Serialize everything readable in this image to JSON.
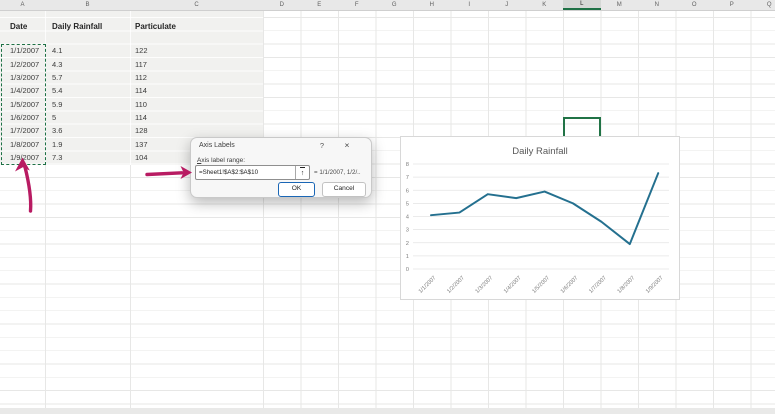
{
  "sheet": {
    "column_letters": [
      "A",
      "B",
      "C",
      "D",
      "E",
      "F",
      "G",
      "H",
      "I",
      "J",
      "K",
      "L",
      "M",
      "N",
      "O",
      "P",
      "Q"
    ],
    "active_column": "L",
    "table": {
      "headers": [
        "Date",
        "Daily Rainfall",
        "Particulate"
      ],
      "rows": [
        [
          "1/1/2007",
          "4.1",
          "122"
        ],
        [
          "1/2/2007",
          "4.3",
          "117"
        ],
        [
          "1/3/2007",
          "5.7",
          "112"
        ],
        [
          "1/4/2007",
          "5.4",
          "114"
        ],
        [
          "1/5/2007",
          "5.9",
          "110"
        ],
        [
          "1/6/2007",
          "5",
          "114"
        ],
        [
          "1/7/2007",
          "3.6",
          "128"
        ],
        [
          "1/8/2007",
          "1.9",
          "137"
        ],
        [
          "1/9/2007",
          "7.3",
          "104"
        ]
      ]
    }
  },
  "dialog": {
    "title": "Axis Labels",
    "help_icon": "?",
    "close_icon": "×",
    "field_label": "Axis label range:",
    "range_value": "=Sheet1!$A$2:$A$10",
    "collapse_icon": "↑",
    "range_preview": "= 1/1/2007, 1/2/..",
    "ok_label": "OK",
    "cancel_label": "Cancel"
  },
  "chart_data": {
    "type": "line",
    "title": "Daily Rainfall",
    "categories": [
      "1/1/2007",
      "1/2/2007",
      "1/3/2007",
      "1/4/2007",
      "1/5/2007",
      "1/6/2007",
      "1/7/2007",
      "1/8/2007",
      "1/9/2007"
    ],
    "series": [
      {
        "name": "Daily Rainfall",
        "values": [
          4.1,
          4.3,
          5.7,
          5.4,
          5.9,
          5,
          3.6,
          1.9,
          7.3
        ]
      }
    ],
    "xlabel": "",
    "ylabel": "",
    "ylim": [
      0,
      8
    ],
    "yticks": [
      0,
      1,
      2,
      3,
      4,
      5,
      6,
      7,
      8
    ],
    "grid": true,
    "legend": "none",
    "line_color": "#24708f",
    "text_color": "#7f7f7f",
    "title_color": "#595959"
  },
  "colors": {
    "excel_green": "#217346",
    "marquee_green": "#1e7145",
    "annotation_arrow": "#b81b62",
    "ok_button_border": "#1a66b5"
  }
}
